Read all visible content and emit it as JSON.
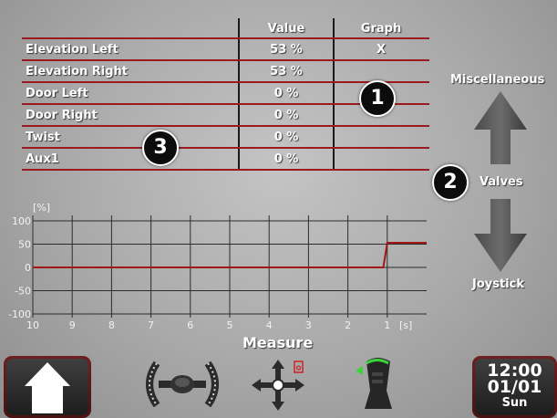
{
  "table": {
    "headers": {
      "label": "",
      "value": "Value",
      "graph": "Graph"
    },
    "rows": [
      {
        "label": "Elevation Left",
        "value": "53 %",
        "graph": "X"
      },
      {
        "label": "Elevation Right",
        "value": "53 %",
        "graph": ""
      },
      {
        "label": "Door Left",
        "value": "0 %",
        "graph": ""
      },
      {
        "label": "Door Right",
        "value": "0 %",
        "graph": ""
      },
      {
        "label": "Twist",
        "value": "0 %",
        "graph": ""
      },
      {
        "label": "Aux1",
        "value": "0 %",
        "graph": ""
      }
    ]
  },
  "badges": {
    "one": "1",
    "two": "2",
    "three": "3"
  },
  "nav": {
    "up_label": "Miscellaneous",
    "current_label": "Valves",
    "down_label": "Joystick"
  },
  "chart_data": {
    "type": "line",
    "ylabel": "[%]",
    "xlabel": "[s]",
    "yticks": [
      "100",
      "50",
      "0",
      "-50",
      "-100"
    ],
    "xticks": [
      "10",
      "9",
      "8",
      "7",
      "6",
      "5",
      "4",
      "3",
      "2",
      "1"
    ],
    "ylim": [
      -100,
      100
    ],
    "xlim": [
      10,
      0
    ],
    "grid": true,
    "series": [
      {
        "color": "#a01818",
        "x": [
          10,
          1.1,
          1.0,
          0
        ],
        "y": [
          0,
          0,
          53,
          53
        ]
      }
    ]
  },
  "footer": {
    "measure_label": "Measure",
    "clock_time": "12:00",
    "clock_date": "01/01",
    "clock_day": "Sun"
  },
  "icons": [
    "home-icon",
    "axle-icon",
    "move-arrows-icon",
    "joystick-icon"
  ],
  "colors": {
    "accent_red": "#a01818",
    "tile_border": "#6e2020"
  }
}
